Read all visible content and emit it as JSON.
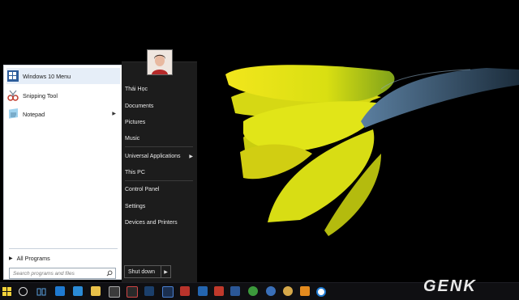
{
  "start_menu": {
    "pinned": [
      {
        "label": "Windows 10 Menu",
        "icon": "windows10-menu-icon",
        "selected": true
      },
      {
        "label": "Snipping Tool",
        "icon": "snipping-tool-icon"
      },
      {
        "label": "Notepad",
        "icon": "notepad-icon",
        "has_submenu": true
      }
    ],
    "all_programs": "All Programs",
    "search_placeholder": "Search programs and files",
    "user_name": "Thái Học",
    "places": [
      {
        "label": "Documents"
      },
      {
        "label": "Pictures"
      },
      {
        "label": "Music"
      },
      {
        "label": "Universal Applications",
        "has_submenu": true
      },
      {
        "label": "This PC"
      },
      {
        "label": "Control Panel"
      },
      {
        "label": "Settings"
      },
      {
        "label": "Devices and Printers"
      }
    ],
    "shutdown_label": "Shut down"
  },
  "taskbar": {
    "pinned_icons": [
      "edge-icon",
      "people-icon",
      "file-explorer-icon",
      "store-icon",
      "media-icon",
      "photoshop-icon",
      "filezilla-icon",
      "shield-icon",
      "mail-icon",
      "word-icon",
      "chat-icon",
      "network-icon",
      "chrome-icon",
      "player-icon",
      "circle-app-icon"
    ]
  },
  "watermark": "GENK",
  "colors": {
    "menu_left_bg": "#ffffff",
    "menu_right_bg": "#1c1c1c",
    "taskbar_bg": "#0f0f12",
    "flower_yellow": "#e3e61a",
    "watermark": "#e8e8e8"
  }
}
